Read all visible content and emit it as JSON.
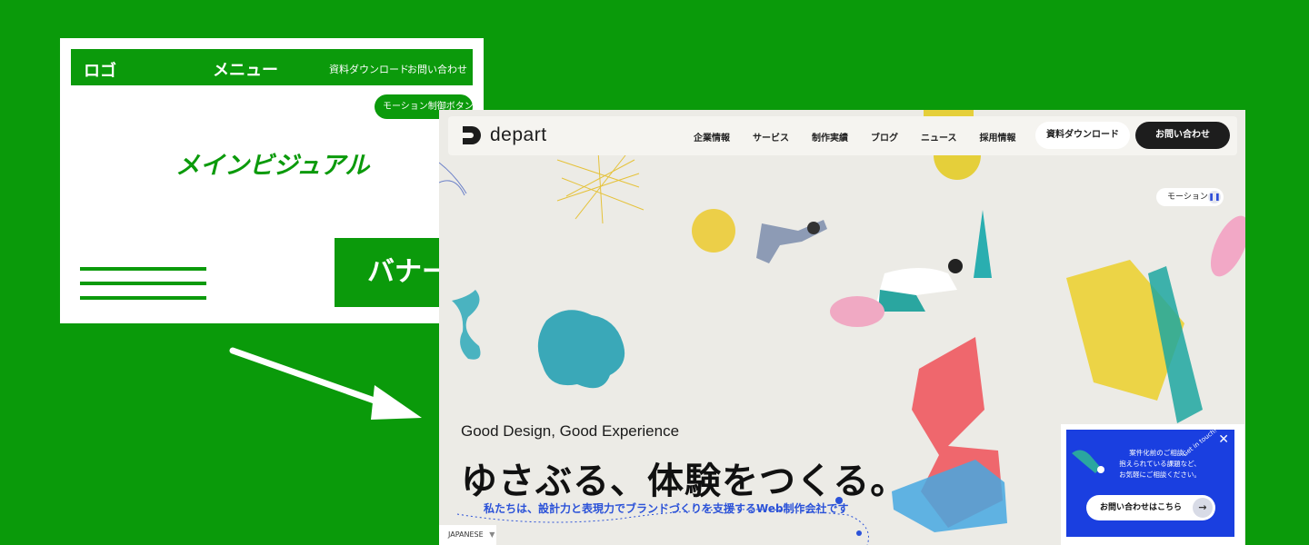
{
  "wireframe": {
    "logo": "ロゴ",
    "menu": "メニュー",
    "download_link": "資料ダウンロード",
    "contact_link": "お問い合わせ",
    "motion_button": "モーション制御ボタン",
    "main_visual": "メインビジュアル",
    "banner": "バナー"
  },
  "site": {
    "logo_text": "depart",
    "nav": [
      "企業情報",
      "サービス",
      "制作実績",
      "ブログ",
      "ニュース",
      "採用情報"
    ],
    "download_button": "資料ダウンロード",
    "contact_button": "お問い合わせ",
    "motion_label": "モーション",
    "motion_icon": "pause-icon",
    "tagline": "Good Design, Good Experience",
    "catch_copy": "ゆさぶる、体験をつくる。",
    "subcopy": "私たちは、設計力と表現力でブランドづくりを支援するWeb制作会社です",
    "language": "JAPANESE",
    "promo": {
      "line1": "案件化前のご相談、",
      "line2": "抱えられている課題など、",
      "line3": "お気軽にご相談ください。",
      "badge": "Get in touch!",
      "button": "お問い合わせはこちら"
    }
  },
  "colors": {
    "background_green": "#0a9a0a",
    "wire_green": "#0b9a0b",
    "site_bg": "#ecebe6",
    "accent_blue": "#2b52d8",
    "promo_blue": "#1a3fe0",
    "dark": "#1d1d1d"
  }
}
